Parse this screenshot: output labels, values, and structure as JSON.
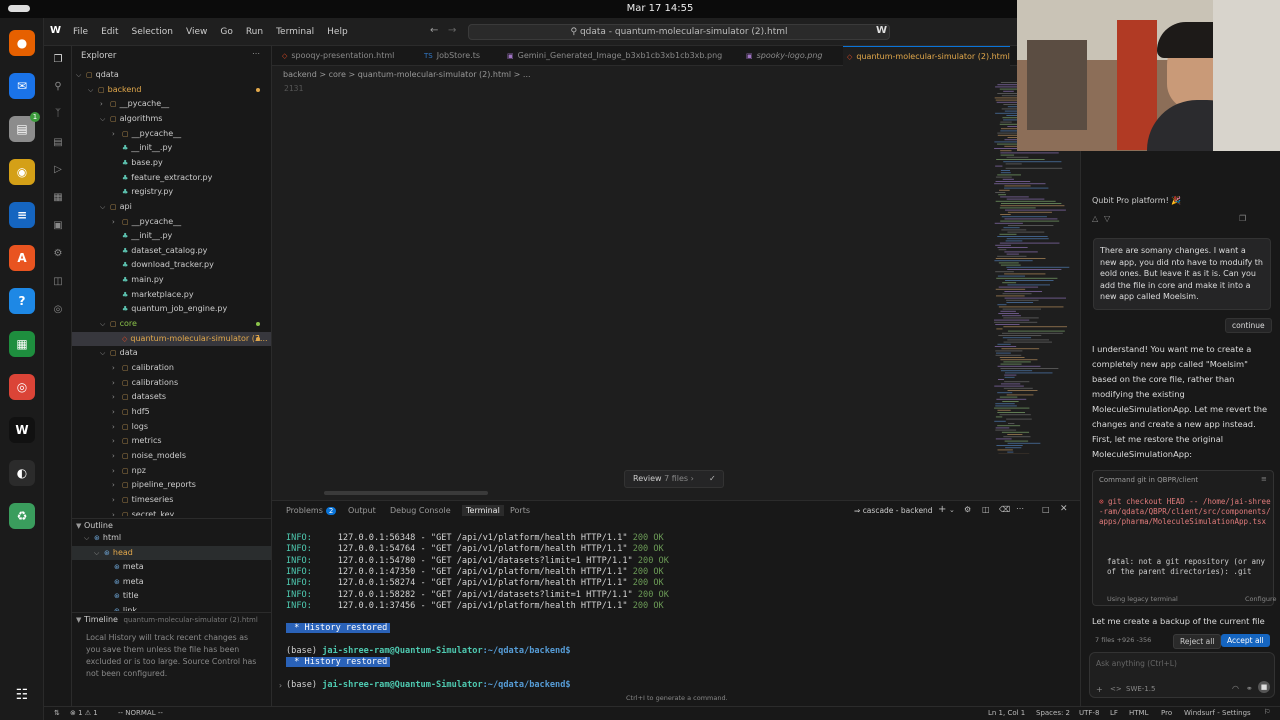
{
  "topbar": {
    "clock": "Mar 17  14:55"
  },
  "dock": {
    "apps": [
      {
        "icon": "firefox-icon",
        "color": "#e66000",
        "glyph": "●"
      },
      {
        "icon": "thunderbird-icon",
        "color": "#1a73e8",
        "glyph": "✉"
      },
      {
        "icon": "files-icon",
        "color": "#8c8c8c",
        "glyph": "▤"
      },
      {
        "icon": "rhythmbox-icon",
        "color": "#d4a017",
        "glyph": "◉"
      },
      {
        "icon": "writer-icon",
        "color": "#1565c0",
        "glyph": "≡"
      },
      {
        "icon": "software-center-icon",
        "color": "#e95420",
        "glyph": "A"
      },
      {
        "icon": "help-icon",
        "color": "#1e88e5",
        "glyph": "?"
      },
      {
        "icon": "calc-icon",
        "color": "#1e8e3e",
        "glyph": "▦"
      },
      {
        "icon": "chrome-icon",
        "color": "#db4437",
        "glyph": "◎"
      },
      {
        "icon": "windsurf-icon",
        "color": "#111111",
        "glyph": "W"
      },
      {
        "icon": "obs-icon",
        "color": "#2b2b2b",
        "glyph": "◐"
      },
      {
        "icon": "trash-icon",
        "color": "#3a9d5d",
        "glyph": "♻"
      }
    ],
    "badge": "1",
    "show_apps_icon": "grid-icon"
  },
  "titlebar": {
    "menus": [
      "File",
      "Edit",
      "Selection",
      "View",
      "Go",
      "Run",
      "Terminal",
      "Help"
    ],
    "search": "qdata - quantum-molecular-simulator (2).html"
  },
  "sidebar": {
    "title": "Explorer",
    "tree": [
      {
        "label": "qdata",
        "depth": 0,
        "chev": "v",
        "kind": "folder"
      },
      {
        "label": "backend",
        "depth": 1,
        "chev": "v",
        "kind": "folder",
        "color": "#e2a84b"
      },
      {
        "label": "__pycache__",
        "depth": 2,
        "chev": ">",
        "kind": "folder"
      },
      {
        "label": "algorithms",
        "depth": 2,
        "chev": "v",
        "kind": "folder"
      },
      {
        "label": "__pycache__",
        "depth": 3,
        "chev": ">",
        "kind": "folder"
      },
      {
        "label": "__init__.py",
        "depth": 3,
        "kind": "py"
      },
      {
        "label": "base.py",
        "depth": 3,
        "kind": "py"
      },
      {
        "label": "feature_extractor.py",
        "depth": 3,
        "kind": "py"
      },
      {
        "label": "registry.py",
        "depth": 3,
        "kind": "py"
      },
      {
        "label": "api",
        "depth": 2,
        "chev": "v",
        "kind": "folder"
      },
      {
        "label": "__pycache__",
        "depth": 3,
        "chev": ">",
        "kind": "folder"
      },
      {
        "label": "__init__.py",
        "depth": 3,
        "kind": "py"
      },
      {
        "label": "dataset_catalog.py",
        "depth": 3,
        "kind": "py"
      },
      {
        "label": "download_tracker.py",
        "depth": 3,
        "kind": "py"
      },
      {
        "label": "main.py",
        "depth": 3,
        "kind": "py"
      },
      {
        "label": "marketplace.py",
        "depth": 3,
        "kind": "py"
      },
      {
        "label": "quantum_job_engine.py",
        "depth": 3,
        "kind": "py"
      },
      {
        "label": "core",
        "depth": 2,
        "chev": "v",
        "kind": "folder",
        "color": "#8bc34a"
      },
      {
        "label": "quantum-molecular-simulator (2...",
        "depth": 3,
        "kind": "html",
        "selected": true,
        "badge": "1"
      },
      {
        "label": "data",
        "depth": 2,
        "chev": "v",
        "kind": "folder"
      },
      {
        "label": "calibration",
        "depth": 3,
        "chev": ">",
        "kind": "folder"
      },
      {
        "label": "calibrations",
        "depth": 3,
        "chev": ">",
        "kind": "folder"
      },
      {
        "label": "datasets",
        "depth": 3,
        "chev": ">",
        "kind": "folder"
      },
      {
        "label": "hdf5",
        "depth": 3,
        "chev": ">",
        "kind": "folder"
      },
      {
        "label": "logs",
        "depth": 3,
        "chev": ">",
        "kind": "folder"
      },
      {
        "label": "metrics",
        "depth": 3,
        "chev": ">",
        "kind": "folder"
      },
      {
        "label": "noise_models",
        "depth": 3,
        "chev": ">",
        "kind": "folder"
      },
      {
        "label": "npz",
        "depth": 3,
        "chev": ">",
        "kind": "folder"
      },
      {
        "label": "pipeline_reports",
        "depth": 3,
        "chev": ">",
        "kind": "folder"
      },
      {
        "label": "timeseries",
        "depth": 3,
        "chev": ">",
        "kind": "folder"
      },
      {
        "label": "secret_key",
        "depth": 3,
        "chev": ">",
        "kind": "folder"
      }
    ],
    "outline_title": "Outline",
    "outline": [
      {
        "label": "html",
        "depth": 0
      },
      {
        "label": "head",
        "depth": 1
      },
      {
        "label": "meta",
        "depth": 2
      },
      {
        "label": "meta",
        "depth": 2
      },
      {
        "label": "title",
        "depth": 2
      },
      {
        "label": "link",
        "depth": 2
      }
    ],
    "timeline_title": "Timeline",
    "timeline_file": "quantum-molecular-simulator (2).html",
    "timeline_text": "Local History will track recent changes as you save them unless the file has been excluded or is too large. Source Control has not been configured."
  },
  "editor": {
    "tabs": [
      {
        "label": "spooqy-presentation.html",
        "icon_color": "#e44d26",
        "glyph": "◇"
      },
      {
        "label": "JobStore.ts",
        "icon_color": "#3178c6",
        "glyph": "TS"
      },
      {
        "label": "Gemini_Generated_Image_b3xb1cb3xb1cb3xb.png",
        "icon_color": "#a074c4",
        "glyph": "▣"
      },
      {
        "label": "spooky-logo.png",
        "icon_color": "#a074c4",
        "glyph": "▣",
        "italic": true
      },
      {
        "label": "quantum-molecular-simulator (2).html",
        "icon_color": "#e44d26",
        "glyph": "◇",
        "active": true
      }
    ],
    "breadcrumb": "backend  >  core  >  quantum-molecular-simulator (2).html  >  ...",
    "line_number": "2131",
    "review_label": "Review",
    "review_files": "7 files"
  },
  "panel": {
    "tabs": [
      "Problems",
      "Output",
      "Debug Console",
      "Terminal",
      "Ports"
    ],
    "problems_count": "2",
    "active_tab": "Terminal",
    "terminal_name": "cascade - backend",
    "logs": [
      {
        "level": "INFO:",
        "addr": "127.0.0.1:56348",
        "req": "\"GET /api/v1/platform/health HTTP/1.1\"",
        "code": "200 OK"
      },
      {
        "level": "INFO:",
        "addr": "127.0.0.1:54764",
        "req": "\"GET /api/v1/platform/health HTTP/1.1\"",
        "code": "200 OK"
      },
      {
        "level": "INFO:",
        "addr": "127.0.0.1:54780",
        "req": "\"GET /api/v1/datasets?limit=1 HTTP/1.1\"",
        "code": "200 OK"
      },
      {
        "level": "INFO:",
        "addr": "127.0.0.1:47350",
        "req": "\"GET /api/v1/platform/health HTTP/1.1\"",
        "code": "200 OK"
      },
      {
        "level": "INFO:",
        "addr": "127.0.0.1:58274",
        "req": "\"GET /api/v1/platform/health HTTP/1.1\"",
        "code": "200 OK"
      },
      {
        "level": "INFO:",
        "addr": "127.0.0.1:58282",
        "req": "\"GET /api/v1/datasets?limit=1 HTTP/1.1\"",
        "code": "200 OK"
      },
      {
        "level": "INFO:",
        "addr": "127.0.0.1:37456",
        "req": "\"GET /api/v1/platform/health HTTP/1.1\"",
        "code": "200 OK"
      }
    ],
    "history_restored": "History restored",
    "prompt_base": "(base)",
    "prompt_user": "jai-shree-ram@Quantum-Simulator",
    "prompt_path": ":~/qdata/backend$",
    "hint": "Ctrl+I to generate a command."
  },
  "chat": {
    "header_text": "Qubit Pro platform! 🎉",
    "user_msg": "There are somany changes. I want a new app, you did nto have to moduify th eold ones. But leave it as it is. Can you add the file in core and make it into a new app called Moelsim.",
    "continue_label": "continue",
    "assistant_msg": "I understand! You want me to create a completely new app called \"Moelsim\" based on the core file, rather than modifying the existing MoleculeSimulationApp. Let me revert the changes and create a new app instead. First, let me restore the original MoleculeSimulationApp:",
    "command_header": "Command git in QBPR/client",
    "command": "git checkout HEAD -- /home/jai-shree-ram/qdata/QBPR/client/src/components/apps/pharma/MoleculeSimulationApp.tsx",
    "command_error": "fatal: not a git repository (or any of the parent directories): .git",
    "legacy_terminal": "Using legacy terminal",
    "configure": "Configure",
    "backup_msg": "Let me create a backup of the current file",
    "files_changed": "7 files +926 -356",
    "reject_all": "Reject all",
    "accept_all": "Accept all",
    "input_placeholder": "Ask anything (Ctrl+L)",
    "model": "SWE-1.5"
  },
  "statusbar": {
    "left": "⊗ 1 ⚠ 1",
    "mode": "-- NORMAL --",
    "position": "Ln 1, Col 1",
    "spaces": "Spaces: 2",
    "encoding": "UTF-8",
    "eol": "LF",
    "language": "HTML",
    "plan": "Pro",
    "windsurf_settings": "Windsurf - Settings"
  },
  "colors": {
    "accent": "#0a74d8",
    "accept": "#1565c0",
    "terminal_user": "#4ec9b0",
    "terminal_path": "#569cd6",
    "ok": "#6a9955"
  }
}
